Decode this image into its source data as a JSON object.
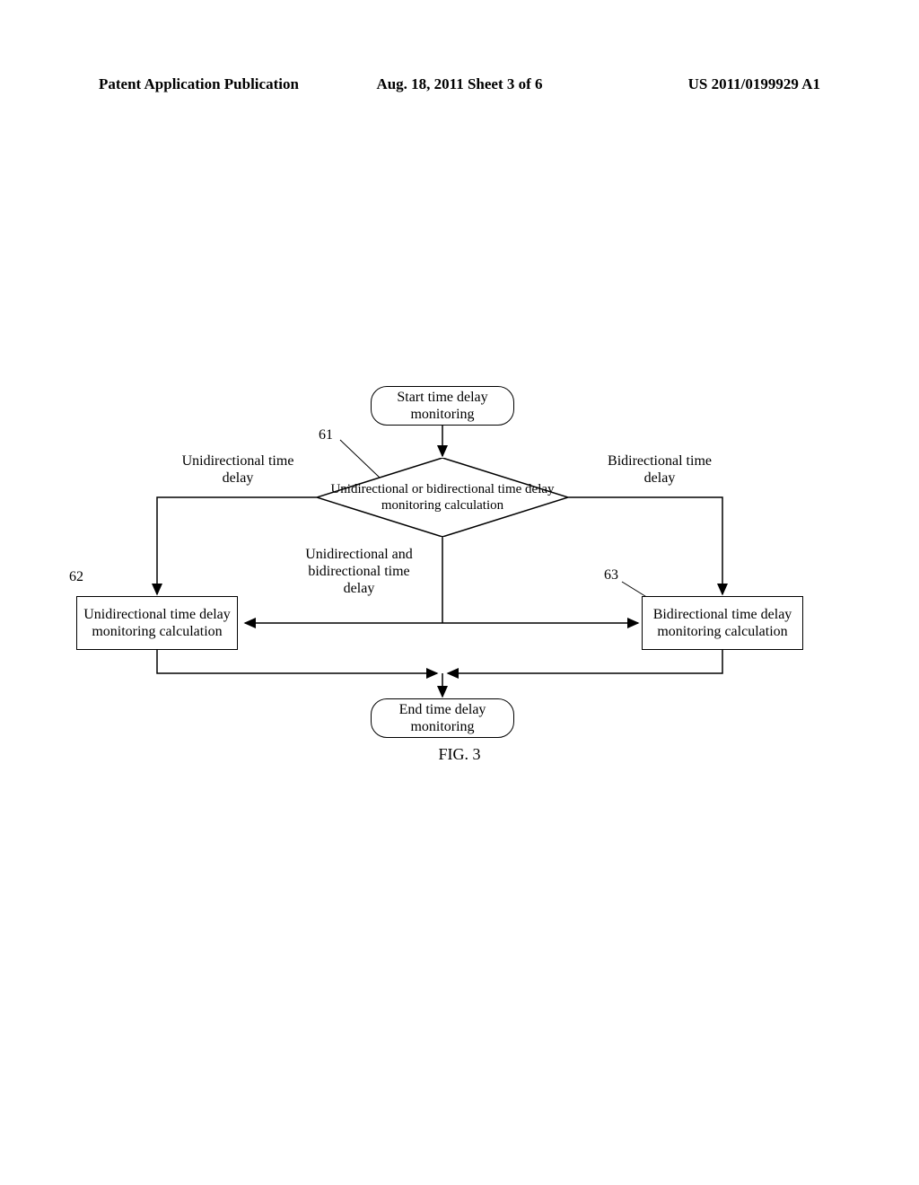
{
  "header": {
    "left": "Patent Application Publication",
    "center": "Aug. 18, 2011  Sheet 3 of 6",
    "right": "US 2011/0199929 A1"
  },
  "nodes": {
    "start": "Start time delay monitoring",
    "decision": "Unidirectional or bidirectional time delay monitoring calculation",
    "process_left": "Unidirectional time delay monitoring calculation",
    "process_right": "Bidirectional time delay monitoring calculation",
    "end": "End time delay monitoring"
  },
  "labels": {
    "left_branch": "Unidirectional time delay",
    "right_branch": "Bidirectional time delay",
    "middle_branch": "Unidirectional and bidirectional time delay",
    "num_61": "61",
    "num_62": "62",
    "num_63": "63"
  },
  "figure": "FIG. 3"
}
